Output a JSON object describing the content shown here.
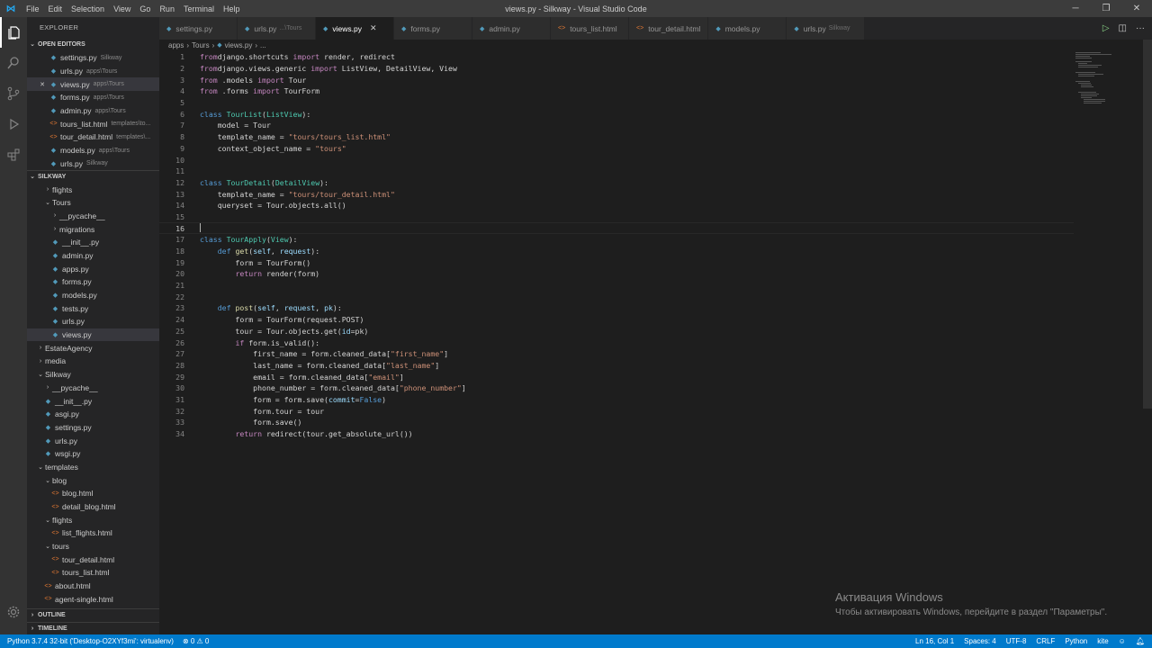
{
  "titlebar": {
    "menu": [
      "File",
      "Edit",
      "Selection",
      "View",
      "Go",
      "Run",
      "Terminal",
      "Help"
    ],
    "title": "views.py - Silkway - Visual Studio Code"
  },
  "sidebar": {
    "title": "EXPLORER",
    "open_editors_label": "OPEN EDITORS",
    "open_editors": [
      {
        "name": "settings.py",
        "desc": "Silkway",
        "type": "py"
      },
      {
        "name": "urls.py",
        "desc": "apps\\Tours",
        "type": "py"
      },
      {
        "name": "views.py",
        "desc": "apps\\Tours",
        "type": "py",
        "active": true
      },
      {
        "name": "forms.py",
        "desc": "apps\\Tours",
        "type": "py"
      },
      {
        "name": "admin.py",
        "desc": "apps\\Tours",
        "type": "py"
      },
      {
        "name": "tours_list.html",
        "desc": "templates\\to...",
        "type": "html"
      },
      {
        "name": "tour_detail.html",
        "desc": "templates\\...",
        "type": "html"
      },
      {
        "name": "models.py",
        "desc": "apps\\Tours",
        "type": "py"
      },
      {
        "name": "urls.py",
        "desc": "Silkway",
        "type": "py"
      }
    ],
    "project_label": "SILKWAY",
    "tree": [
      {
        "name": "flights",
        "type": "folder",
        "indent": 1,
        "open": false
      },
      {
        "name": "Tours",
        "type": "folder",
        "indent": 1,
        "open": true
      },
      {
        "name": "__pycache__",
        "type": "folder",
        "indent": 2,
        "open": false
      },
      {
        "name": "migrations",
        "type": "folder",
        "indent": 2,
        "open": false
      },
      {
        "name": "__init__.py",
        "type": "py",
        "indent": 2
      },
      {
        "name": "admin.py",
        "type": "py",
        "indent": 2
      },
      {
        "name": "apps.py",
        "type": "py",
        "indent": 2
      },
      {
        "name": "forms.py",
        "type": "py",
        "indent": 2
      },
      {
        "name": "models.py",
        "type": "py",
        "indent": 2
      },
      {
        "name": "tests.py",
        "type": "py",
        "indent": 2
      },
      {
        "name": "urls.py",
        "type": "py",
        "indent": 2
      },
      {
        "name": "views.py",
        "type": "py",
        "indent": 2,
        "selected": true
      },
      {
        "name": "EstateAgency",
        "type": "folder",
        "indent": 0,
        "open": false
      },
      {
        "name": "media",
        "type": "folder",
        "indent": 0,
        "open": false
      },
      {
        "name": "Silkway",
        "type": "folder",
        "indent": 0,
        "open": true
      },
      {
        "name": "__pycache__",
        "type": "folder",
        "indent": 1,
        "open": false
      },
      {
        "name": "__init__.py",
        "type": "py",
        "indent": 1
      },
      {
        "name": "asgi.py",
        "type": "py",
        "indent": 1
      },
      {
        "name": "settings.py",
        "type": "py",
        "indent": 1
      },
      {
        "name": "urls.py",
        "type": "py",
        "indent": 1
      },
      {
        "name": "wsgi.py",
        "type": "py",
        "indent": 1
      },
      {
        "name": "templates",
        "type": "folder",
        "indent": 0,
        "open": true
      },
      {
        "name": "blog",
        "type": "folder",
        "indent": 1,
        "open": true
      },
      {
        "name": "blog.html",
        "type": "html",
        "indent": 2
      },
      {
        "name": "detail_blog.html",
        "type": "html",
        "indent": 2
      },
      {
        "name": "flights",
        "type": "folder",
        "indent": 1,
        "open": true
      },
      {
        "name": "list_flights.html",
        "type": "html",
        "indent": 2
      },
      {
        "name": "tours",
        "type": "folder",
        "indent": 1,
        "open": true
      },
      {
        "name": "tour_detail.html",
        "type": "html",
        "indent": 2
      },
      {
        "name": "tours_list.html",
        "type": "html",
        "indent": 2
      },
      {
        "name": "about.html",
        "type": "html",
        "indent": 1
      },
      {
        "name": "agent-single.html",
        "type": "html",
        "indent": 1
      }
    ],
    "outline_label": "OUTLINE",
    "timeline_label": "TIMELINE"
  },
  "tabs": [
    {
      "name": "settings.py",
      "type": "py"
    },
    {
      "name": "urls.py",
      "desc": "...\\Tours",
      "type": "py"
    },
    {
      "name": "views.py",
      "type": "py",
      "active": true
    },
    {
      "name": "forms.py",
      "type": "py"
    },
    {
      "name": "admin.py",
      "type": "py"
    },
    {
      "name": "tours_list.html",
      "type": "html"
    },
    {
      "name": "tour_detail.html",
      "type": "html"
    },
    {
      "name": "models.py",
      "type": "py"
    },
    {
      "name": "urls.py",
      "desc": "Silkway",
      "type": "py"
    }
  ],
  "breadcrumb": [
    "apps",
    "Tours",
    "views.py",
    "..."
  ],
  "code": [
    [
      [
        "kw",
        "from"
      ],
      [
        "",
        "django.shortcuts "
      ],
      [
        "kw",
        "import"
      ],
      [
        "",
        " render, redirect"
      ]
    ],
    [
      [
        "kw",
        "from"
      ],
      [
        "",
        "django.views.generic "
      ],
      [
        "kw",
        "import"
      ],
      [
        "",
        " ListView, DetailView, View"
      ]
    ],
    [
      [
        "kw",
        "from"
      ],
      [
        "",
        " .models "
      ],
      [
        "kw",
        "import"
      ],
      [
        "",
        " Tour"
      ]
    ],
    [
      [
        "kw",
        "from"
      ],
      [
        "",
        " .forms "
      ],
      [
        "kw",
        "import"
      ],
      [
        "",
        " TourForm"
      ]
    ],
    [],
    [
      [
        "kwb",
        "class"
      ],
      [
        "",
        " "
      ],
      [
        "cls",
        "TourList"
      ],
      [
        "",
        "("
      ],
      [
        "cls",
        "ListView"
      ],
      [
        "",
        "):"
      ]
    ],
    [
      [
        "",
        "    model = Tour"
      ]
    ],
    [
      [
        "",
        "    template_name = "
      ],
      [
        "str",
        "\"tours/tours_list.html\""
      ]
    ],
    [
      [
        "",
        "    context_object_name = "
      ],
      [
        "str",
        "\"tours\""
      ]
    ],
    [],
    [],
    [
      [
        "kwb",
        "class"
      ],
      [
        "",
        " "
      ],
      [
        "cls",
        "TourDetail"
      ],
      [
        "",
        "("
      ],
      [
        "cls",
        "DetailView"
      ],
      [
        "",
        "):"
      ]
    ],
    [
      [
        "",
        "    template_name = "
      ],
      [
        "str",
        "\"tours/tour_detail.html\""
      ]
    ],
    [
      [
        "",
        "    queryset = Tour.objects.all()"
      ]
    ],
    [],
    [],
    [
      [
        "kwb",
        "class"
      ],
      [
        "",
        " "
      ],
      [
        "cls",
        "TourApply"
      ],
      [
        "",
        "("
      ],
      [
        "cls",
        "View"
      ],
      [
        "",
        "):"
      ]
    ],
    [
      [
        "",
        "    "
      ],
      [
        "kwb",
        "def"
      ],
      [
        "",
        " "
      ],
      [
        "fn",
        "get"
      ],
      [
        "",
        "("
      ],
      [
        "var",
        "self"
      ],
      [
        "",
        ", "
      ],
      [
        "var",
        "request"
      ],
      [
        "",
        "):"
      ]
    ],
    [
      [
        "",
        "        form = TourForm()"
      ]
    ],
    [
      [
        "",
        "        "
      ],
      [
        "kw",
        "return"
      ],
      [
        "",
        " render(form)"
      ]
    ],
    [],
    [],
    [
      [
        "",
        "    "
      ],
      [
        "kwb",
        "def"
      ],
      [
        "",
        " "
      ],
      [
        "fn",
        "post"
      ],
      [
        "",
        "("
      ],
      [
        "var",
        "self"
      ],
      [
        "",
        ", "
      ],
      [
        "var",
        "request"
      ],
      [
        "",
        ", "
      ],
      [
        "var",
        "pk"
      ],
      [
        "",
        "):"
      ]
    ],
    [
      [
        "",
        "        form = TourForm(request.POST)"
      ]
    ],
    [
      [
        "",
        "        tour = Tour.objects.get("
      ],
      [
        "var",
        "id"
      ],
      [
        "",
        "=pk)"
      ]
    ],
    [
      [
        "",
        "        "
      ],
      [
        "kw",
        "if"
      ],
      [
        "",
        " form.is_valid():"
      ]
    ],
    [
      [
        "",
        "            first_name = form.cleaned_data["
      ],
      [
        "str",
        "\"first_name\""
      ],
      [
        "",
        "]"
      ]
    ],
    [
      [
        "",
        "            last_name = form.cleaned_data["
      ],
      [
        "str",
        "\"last_name\""
      ],
      [
        "",
        "]"
      ]
    ],
    [
      [
        "",
        "            email = form.cleaned_data["
      ],
      [
        "str",
        "\"email\""
      ],
      [
        "",
        "]"
      ]
    ],
    [
      [
        "",
        "            phone_number = form.cleaned_data["
      ],
      [
        "str",
        "\"phone_number\""
      ],
      [
        "",
        "]"
      ]
    ],
    [
      [
        "",
        "            form = form.save("
      ],
      [
        "var",
        "commit"
      ],
      [
        "",
        "="
      ],
      [
        "kwb",
        "False"
      ],
      [
        "",
        ")"
      ]
    ],
    [
      [
        "",
        "            form.tour = tour"
      ]
    ],
    [
      [
        "",
        "            form.save()"
      ]
    ],
    [
      [
        "",
        "        "
      ],
      [
        "kw",
        "return"
      ],
      [
        "",
        " redirect(tour.get_absolute_url())"
      ]
    ]
  ],
  "current_line": 16,
  "watermark": {
    "line1": "Активация Windows",
    "line2": "Чтобы активировать Windows, перейдите в раздел \"Параметры\"."
  },
  "statusbar": {
    "interpreter": "Python 3.7.4 32-bit ('Desktop-O2XYf3mi': virtualenv)",
    "problems": "⊗ 0 ⚠ 0",
    "position": "Ln 16, Col 1",
    "spaces": "Spaces: 4",
    "encoding": "UTF-8",
    "eol": "CRLF",
    "language": "Python",
    "extra": "kite"
  }
}
